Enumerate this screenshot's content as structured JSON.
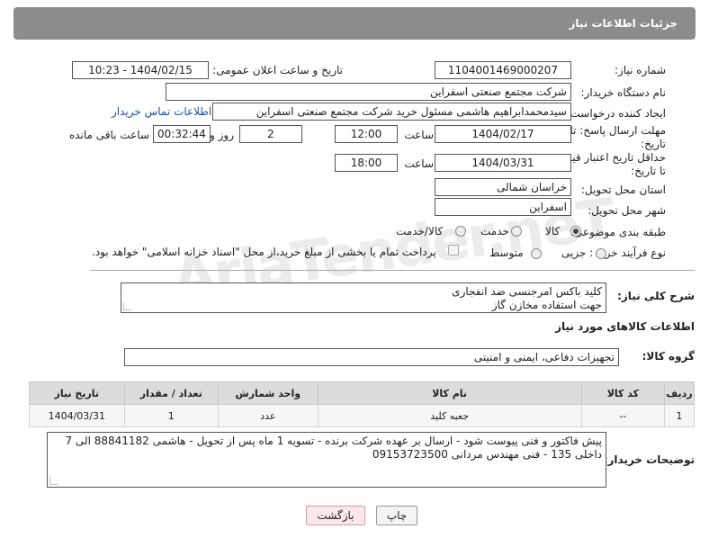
{
  "header": {
    "title": "جزئیات اطلاعات نیاز"
  },
  "form": {
    "need_number_label": "شماره نیاز:",
    "need_number": "1104001469000207",
    "announce_label": "تاریخ و ساعت اعلان عمومی:",
    "announce_value": "1404/02/15 - 10:23",
    "buyer_org_label": "نام دستگاه خریدار:",
    "buyer_org": "شرکت مجتمع صنعتی اسفراین",
    "creator_label": "ایجاد کننده درخواست:",
    "creator": "سیدمحمدابراهیم هاشمی مسئول خرید شرکت مجتمع صنعتی اسفراین",
    "contact_link": "اطلاعات تماس خریدار",
    "reply_deadline_label_1": "مهلت ارسال پاسخ: تا",
    "reply_deadline_label_2": "تاریخ:",
    "reply_date": "1404/02/17",
    "time_label": "ساعت",
    "reply_time": "12:00",
    "days": "2",
    "days_label": "روز و",
    "remaining_time": "00:32:44",
    "remaining_label": "ساعت باقی مانده",
    "price_deadline_label_1": "حداقل تاریخ اعتبار قیمت:",
    "price_deadline_label_2": "تا تاریخ:",
    "price_date": "1404/03/31",
    "price_time": "18:00",
    "province_label": "استان محل تحویل:",
    "province": "خراسان شمالی",
    "city_label": "شهر محل تحویل:",
    "city": "اسفراین",
    "category_label": "طبقه بندی موضوعی:",
    "category_options": [
      "کالا",
      "خدمت",
      "کالا/خدمت"
    ],
    "process_label": "نوع فرآیند خرید :",
    "process_options": [
      "جزیی",
      "متوسط"
    ],
    "payment_note": "پرداخت تمام یا بخشی از مبلغ خرید،از محل \"اسناد خزانه اسلامی\" خواهد بود."
  },
  "description": {
    "label": "شرح کلی نیاز:",
    "line1": "کلید باکس امرجنسی ضد انفجاری",
    "line2": "جهت استفاده مخازن گاز"
  },
  "goods": {
    "section_title": "اطلاعات کالاهای مورد نیاز",
    "group_label": "گروه کالا:",
    "group_value": "تجهیزات دفاعی، ایمنی و امنیتی",
    "columns": [
      "ردیف",
      "کد کالا",
      "نام کالا",
      "واحد شمارش",
      "تعداد / مقدار",
      "تاریخ نیاز"
    ],
    "rows": [
      [
        "1",
        "--",
        "جعبه کلید",
        "عدد",
        "1",
        "1404/03/31"
      ]
    ]
  },
  "buyer_notes": {
    "label": "توضیحات خریدار:",
    "line1": "پیش فاکتور و فنی پیوست شود - ارسال بر عهده شرکت برنده - تسویه 1 ماه پس از تحویل - هاشمی 88841182 الی 7",
    "line2": "داخلی 135 - فنی مهندس مردانی 09153723500"
  },
  "buttons": {
    "print": "چاپ",
    "back": "بازگشت"
  },
  "watermark": "AriaTender.neT"
}
